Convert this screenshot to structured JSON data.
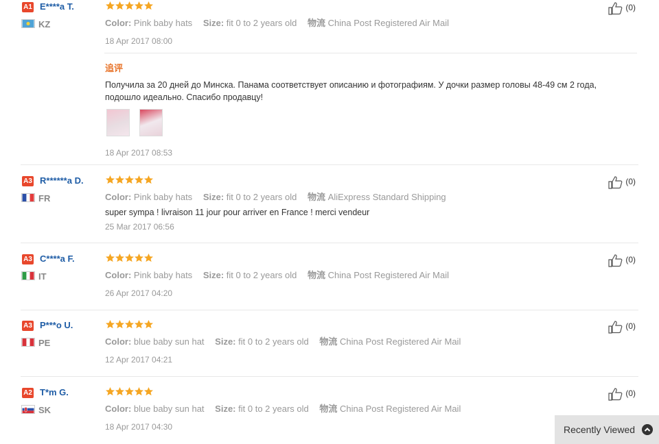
{
  "reviews": [
    {
      "level": "A1",
      "level_color": "#e8472c",
      "user": "E****a T.",
      "country": "KZ",
      "stars": 5,
      "color": "Pink baby hats",
      "size": "fit 0 to 2 years old",
      "shipping": "China Post Registered Air Mail",
      "text": "",
      "date": "18 Apr 2017 08:00",
      "likes": "(0)"
    },
    {
      "level": "A3",
      "level_color": "#e8472c",
      "user": "R******a D.",
      "country": "FR",
      "stars": 5,
      "color": "Pink baby hats",
      "size": "fit 0 to 2 years old",
      "shipping": "AliExpress Standard Shipping",
      "text": "super sympa ! livraison 11 jour pour arriver en France ! merci vendeur",
      "date": "25 Mar 2017 06:56",
      "likes": "(0)"
    },
    {
      "level": "A3",
      "level_color": "#e8472c",
      "user": "C****a F.",
      "country": "IT",
      "stars": 5,
      "color": "Pink baby hats",
      "size": "fit 0 to 2 years old",
      "shipping": "China Post Registered Air Mail",
      "text": "",
      "date": "26 Apr 2017 04:20",
      "likes": "(0)"
    },
    {
      "level": "A3",
      "level_color": "#e8472c",
      "user": "P***o U.",
      "country": "PE",
      "stars": 5,
      "color": "blue baby sun hat",
      "size": "fit 0 to 2 years old",
      "shipping": "China Post Registered Air Mail",
      "text": "",
      "date": "12 Apr 2017 04:21",
      "likes": "(0)"
    },
    {
      "level": "A2",
      "level_color": "#e8472c",
      "user": "T*m G.",
      "country": "SK",
      "stars": 5,
      "color": "blue baby sun hat",
      "size": "fit 0 to 2 years old",
      "shipping": "China Post Registered Air Mail",
      "text": "",
      "date": "18 Apr 2017 04:30",
      "likes": "(0)"
    }
  ],
  "followup": {
    "label": "追评",
    "text": "Получила за 20 дней до Минска. Панама соответствует описанию и фотографиям. У дочки размер головы 48-49 см 2 года, подошло идеально. Спасибо продавцу!",
    "date": "18 Apr 2017 08:53"
  },
  "labels": {
    "color": "Color:",
    "size": "Size:",
    "shipping": "物流"
  },
  "recently_viewed": "Recently Viewed",
  "colors": {
    "star": "#f5a623",
    "username": "#1f5da6",
    "level_badge": "#e8472c",
    "followup_label": "#e8752c"
  }
}
